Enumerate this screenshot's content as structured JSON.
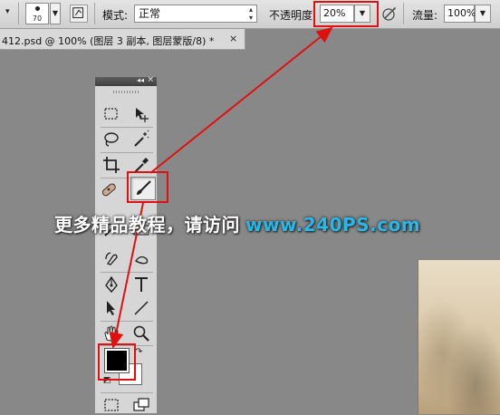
{
  "options_bar": {
    "brush_size": "70",
    "mode_label": "模式:",
    "mode_value": "正常",
    "opacity_label": "不透明度:",
    "opacity_value": "20%",
    "flow_label": "流量:",
    "flow_value": "100%"
  },
  "document_tab": {
    "title": "412.psd @ 100% (图层 3 副本, 图层蒙版/8) *",
    "close": "×"
  },
  "tools_panel": {
    "collapse_glyph": "◂◂",
    "close_glyph": "×",
    "foreground_color": "#000000",
    "background_color": "#ffffff",
    "tools": [
      "marquee-tool",
      "move-tool",
      "lasso-tool",
      "magic-wand-tool",
      "crop-tool",
      "eyedropper-tool",
      "healing-brush-tool",
      "brush-tool",
      "history-brush-tool",
      "gradient-tool",
      "pen-tool",
      "type-tool",
      "path-selection-tool",
      "line-tool",
      "hand-tool",
      "zoom-tool"
    ],
    "active_tool": "brush-tool"
  },
  "watermark": {
    "text": "更多精品教程，请访问",
    "url": "www.240PS.com"
  },
  "colors": {
    "workspace": "#888888",
    "annotation_red": "#e01010",
    "watermark_url": "#29b7e8"
  }
}
